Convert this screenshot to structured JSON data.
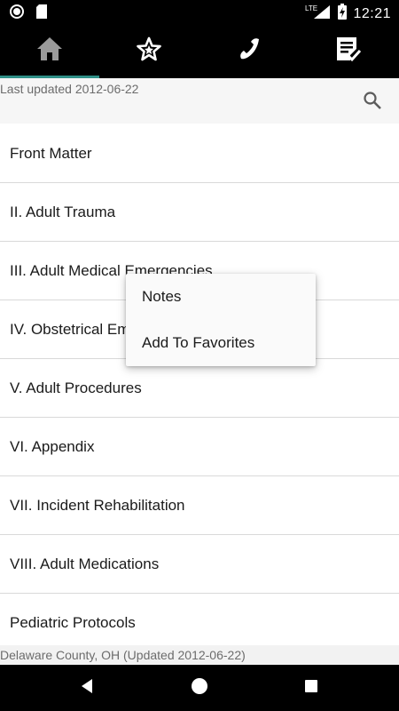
{
  "status_bar": {
    "network": "LTE",
    "time": "12:21"
  },
  "tabs": [
    {
      "icon": "home-icon",
      "active": true
    },
    {
      "icon": "star-icon",
      "active": false
    },
    {
      "icon": "phone-icon",
      "active": false
    },
    {
      "icon": "checklist-icon",
      "active": false
    }
  ],
  "header": {
    "last_updated": "Last updated 2012-06-22",
    "search_icon": "search-icon"
  },
  "list": {
    "items": [
      "Front Matter",
      "II. Adult Trauma",
      "III. Adult Medical Emergencies",
      "IV. Obstetrical Emergencies",
      "V. Adult Procedures",
      "VI. Appendix",
      "VII. Incident Rehabilitation",
      "VIII. Adult Medications",
      "Pediatric Protocols"
    ]
  },
  "context_menu": {
    "items": [
      "Notes",
      "Add To Favorites"
    ]
  },
  "footer": {
    "text": "Delaware County, OH (Updated 2012-06-22)"
  },
  "nav_bar": {
    "back_icon": "back-icon",
    "home_icon": "home-circle-icon",
    "recents_icon": "recents-icon"
  },
  "colors": {
    "tab_indicator": "#2f8f86",
    "bars": "#000000",
    "toolbar": "#f6f6f6"
  }
}
